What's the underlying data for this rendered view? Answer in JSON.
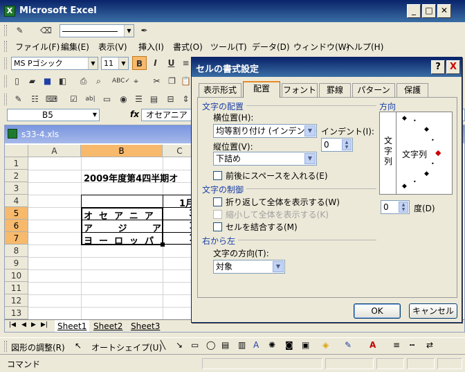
{
  "app": {
    "title": "Microsoft Excel"
  },
  "menu": [
    "ファイル(F)",
    "編集(E)",
    "表示(V)",
    "挿入(I)",
    "書式(O)",
    "ツール(T)",
    "データ(D)",
    "ウィンドウ(W)",
    "ヘルプ(H)"
  ],
  "format_toolbar": {
    "font_name": "MS Pゴシック",
    "font_size": "11",
    "bold": "B",
    "italic": "I",
    "underline": "U"
  },
  "formula_bar": {
    "name_box": "B5",
    "fx": "fx",
    "value": "オセアニア"
  },
  "workbook": {
    "filename": "s33-4.xls",
    "columns": [
      "A",
      "B",
      "C"
    ],
    "rows": [
      "1",
      "2",
      "3",
      "4",
      "5",
      "6",
      "7",
      "8",
      "9",
      "10",
      "11",
      "12",
      "13"
    ],
    "cells": {
      "b2": "2009年度第4四半期オ",
      "c4": "1月",
      "b5": "オセアニア",
      "b6": "ア ジ ア",
      "b7": "ヨーロッパ",
      "c5": "3",
      "c6": "1",
      "c7": "1"
    },
    "sheets": [
      "Sheet1",
      "Sheet2",
      "Sheet3"
    ]
  },
  "draw_toolbar": {
    "adjust": "図形の調整(R)",
    "autoshape": "オートシェイプ(U)"
  },
  "status": {
    "text": "コマンド"
  },
  "dialog": {
    "title": "セルの書式設定",
    "help": "?",
    "close": "X",
    "tabs": [
      "表示形式",
      "配置",
      "フォント",
      "罫線",
      "パターン",
      "保護"
    ],
    "text_alignment": {
      "group_title": "文字の配置",
      "horizontal_label": "横位置(H):",
      "horizontal_value": "均等割り付け (インデント)",
      "indent_label": "インデント(I):",
      "indent_value": "0",
      "vertical_label": "縦位置(V):",
      "vertical_value": "下詰め",
      "justify_distributed": "前後にスペースを入れる(E)"
    },
    "text_control": {
      "group_title": "文字の制御",
      "wrap": "折り返して全体を表示する(W)",
      "shrink": "縮小して全体を表示する(K)",
      "merge": "セルを結合する(M)"
    },
    "rtl": {
      "group_title": "右から左",
      "direction_label": "文字の方向(T):",
      "direction_value": "対象"
    },
    "orientation": {
      "group_title": "方向",
      "vertical_text": "文字列",
      "text_label": "文字列",
      "degrees_value": "0",
      "degrees_label": "度(D)"
    },
    "ok": "OK",
    "cancel": "キャンセル"
  }
}
